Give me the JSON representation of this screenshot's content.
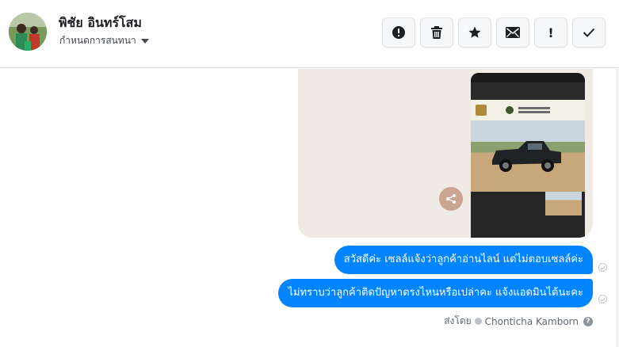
{
  "header": {
    "contact_name": "พิชัย อินทร์โสม",
    "assign_label": "กำหนดการสนทนา",
    "actions": [
      {
        "name": "report-spam-icon",
        "label": ""
      },
      {
        "name": "trash-icon",
        "label": ""
      },
      {
        "name": "star-icon",
        "label": ""
      },
      {
        "name": "mail-icon",
        "label": ""
      },
      {
        "name": "mark-important-icon",
        "label": "!"
      },
      {
        "name": "checkmark-icon",
        "label": ""
      }
    ]
  },
  "messages": [
    {
      "text": "สวัสดีค่ะ เซลล์แจ้งว่าลูกค้าอ่านไลน์ แต่ไม่ตอบเซลล์ค่ะ"
    },
    {
      "text": "ไม่ทราบว่าลูกค้าติดปัญหาตรงไหนหรือเปล่าคะ แจ้งแอดมินได้นะคะ"
    }
  ],
  "sent_by": {
    "prefix": "ส่งโดย",
    "name": "Chonticha Kamborn"
  },
  "colors": {
    "bubble": "#0084ff",
    "border": "#dadde1"
  }
}
